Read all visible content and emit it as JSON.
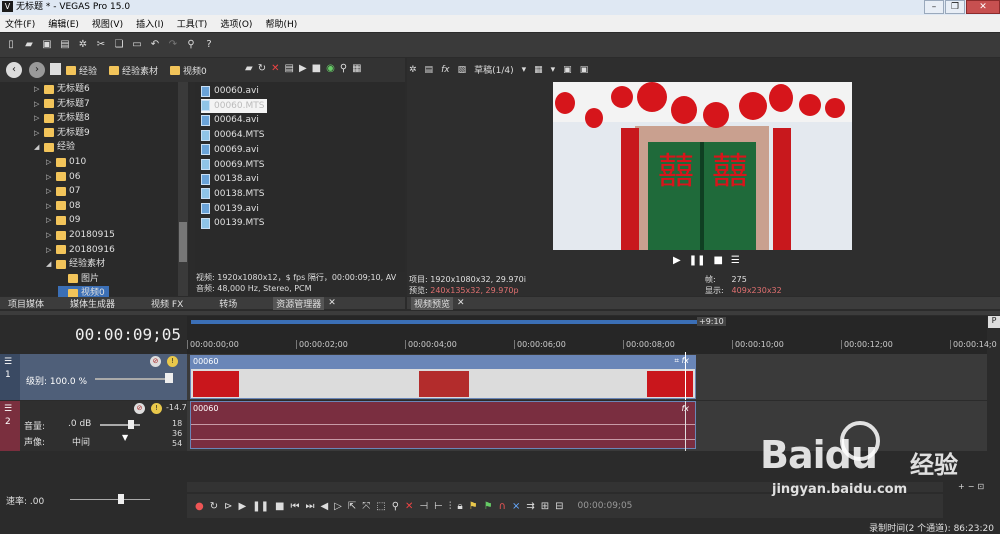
{
  "window": {
    "title": "无标题 * - VEGAS Pro 15.0",
    "logo": "V"
  },
  "menu": [
    "文件(F)",
    "编辑(E)",
    "视图(V)",
    "插入(I)",
    "工具(T)",
    "选项(O)",
    "帮助(H)"
  ],
  "explorer": {
    "breadcrumb": [
      "经验",
      "经验素材",
      "视频0"
    ],
    "tree": [
      {
        "label": "无标题6",
        "indent": 3
      },
      {
        "label": "无标题7",
        "indent": 3
      },
      {
        "label": "无标题8",
        "indent": 3
      },
      {
        "label": "无标题9",
        "indent": 3
      },
      {
        "label": "经验",
        "indent": 3,
        "expanded": true
      },
      {
        "label": "010",
        "indent": 4
      },
      {
        "label": "06",
        "indent": 4
      },
      {
        "label": "07",
        "indent": 4
      },
      {
        "label": "08",
        "indent": 4
      },
      {
        "label": "09",
        "indent": 4
      },
      {
        "label": "20180915",
        "indent": 4
      },
      {
        "label": "20180916",
        "indent": 4
      },
      {
        "label": "经验素材",
        "indent": 4,
        "expanded": true
      },
      {
        "label": "图片",
        "indent": 5
      },
      {
        "label": "视频0",
        "indent": 5,
        "selected": true
      }
    ],
    "files": [
      "00060.avi",
      "00060.MTS",
      "00064.avi",
      "00064.MTS",
      "00069.avi",
      "00069.MTS",
      "00138.avi",
      "00138.MTS",
      "00139.avi",
      "00139.MTS"
    ],
    "selected_file": "00060.MTS",
    "info_video": "视频: 1920x1080x12，$ fps 隔行，00:00:09;10, AV",
    "info_audio": "音频: 48,000 Hz, Stereo, PCM",
    "tabs": [
      "项目媒体",
      "媒体生成器",
      "视频 FX",
      "转场",
      "资源管理器"
    ]
  },
  "preview": {
    "quality": "草稿(1/4)",
    "project_label": "项目:",
    "project_value": "1920x1080x32, 29.970i",
    "preview_label": "预览:",
    "preview_value": "240x135x32, 29.970p",
    "frame_label": "帧:",
    "frame_value": "275",
    "display_label": "显示:",
    "display_value": "409x230x32",
    "tab": "视频预览",
    "sign_char": "囍"
  },
  "timeline": {
    "timecode": "00:00:09;05",
    "end_marker": "+9:10",
    "ruler": [
      "00:00:00;00",
      "00:00:02;00",
      "00:00:04;00",
      "00:00:06;00",
      "00:00:08;00",
      "00:00:10;00",
      "00:00:12;00",
      "00:00:14;0"
    ],
    "video_track": {
      "number": "1",
      "level_label": "级别: 100.0 %",
      "clip": "00060"
    },
    "audio_track": {
      "number": "2",
      "volume_label": "音量:",
      "volume_value": ".0 dB",
      "pan_label": "声像:",
      "pan_value": "中间",
      "clip": "00060",
      "meter_top": "-14.7",
      "meter_ticks": [
        "18",
        "36",
        "54"
      ]
    },
    "rate": "速率: .00",
    "timecode_small": "00:00:09;05"
  },
  "status": {
    "record_time": "录制时间(2 个通道): 86:23:20"
  },
  "watermark": {
    "brand": "Baidu",
    "cn": "经验",
    "url": "jingyan.baidu.com"
  },
  "colors": {
    "accent": "#3b6fb6",
    "video_header": "#4f5f79",
    "audio_header": "#7a2f3e",
    "audio_clip": "#7a2e40",
    "video_clip": "#6a86b8"
  }
}
